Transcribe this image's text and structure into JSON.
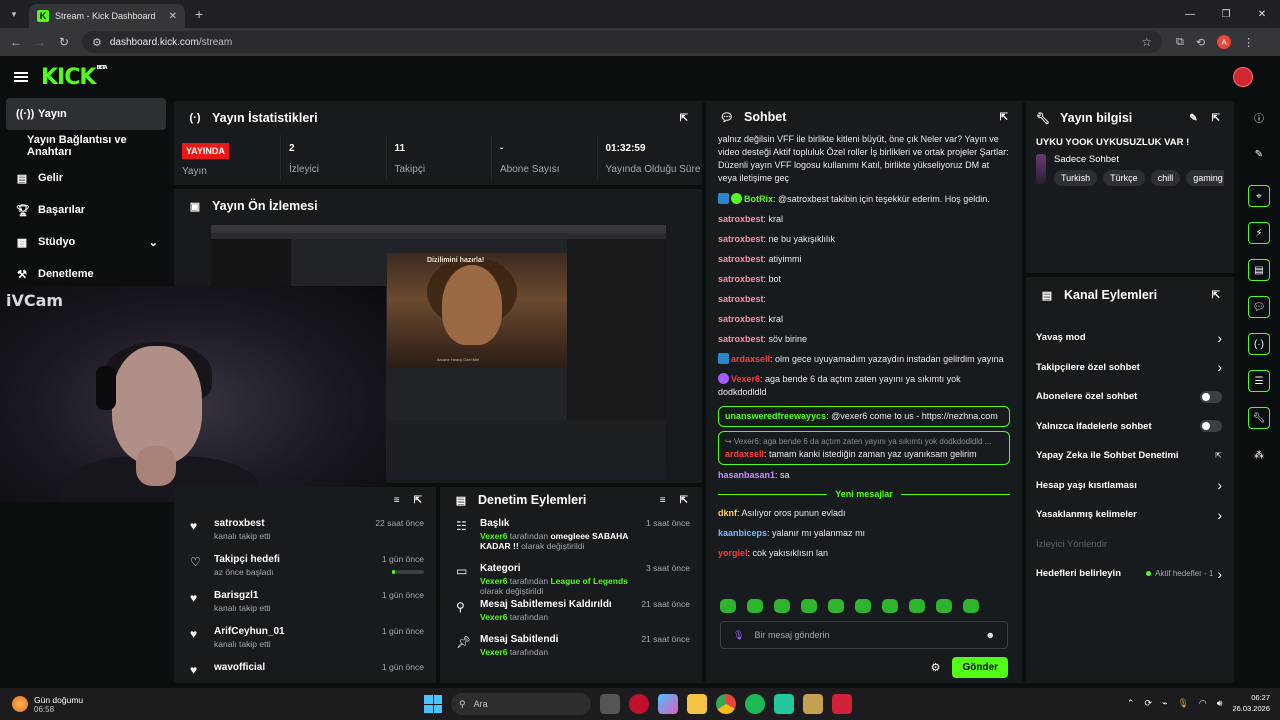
{
  "browser": {
    "tab_title": "Stream - Kick Dashboard",
    "url_host": "dashboard.kick.com",
    "url_path": "/stream",
    "profile_initial": "A"
  },
  "kick": {
    "logo": "KICK",
    "beta": "BETA"
  },
  "sidebar": {
    "items": [
      {
        "label": "Yayın",
        "icon": "broadcast-icon"
      },
      {
        "label": "Yayın Bağlantısı ve Anahtarı"
      },
      {
        "label": "Gelir",
        "icon": "chart-icon"
      },
      {
        "label": "Başarılar",
        "icon": "trophy-icon"
      },
      {
        "label": "Stüdyo",
        "icon": "studio-icon"
      },
      {
        "label": "Denetleme",
        "icon": "hammer-icon"
      }
    ]
  },
  "stats": {
    "title": "Yayın İstatistikleri",
    "live_badge": "YAYINDA",
    "status_label": "Yayın",
    "cells": [
      {
        "value": "2",
        "label": "İzleyici"
      },
      {
        "value": "11",
        "label": "Takipçi"
      },
      {
        "value": "-",
        "label": "Abone Sayısı"
      },
      {
        "value": "01:32:59",
        "label": "Yayında Olduğu Süre"
      }
    ]
  },
  "preview": {
    "title": "Yayın Ön İzlemesi",
    "overlay": "Dizilimini hazırla!",
    "caption": "Arcane Heavy Özel Mel"
  },
  "webcam": {
    "label": "iVCam"
  },
  "activity": {
    "items": [
      {
        "title": "satroxbest",
        "sub": "kanalı takip etti",
        "time": "22 saat önce"
      },
      {
        "title": "Takipçi hedefi",
        "sub": "az önce başladı",
        "time": "1 gün önce",
        "progress": 0.1
      },
      {
        "title": "Barisgzl1",
        "sub": "kanalı takip etti",
        "time": "1 gün önce"
      },
      {
        "title": "ArifCeyhun_01",
        "sub": "kanalı takip etti",
        "time": "1 gün önce"
      },
      {
        "title": "wavofficial",
        "sub": "",
        "time": "1 gün önce"
      }
    ]
  },
  "moderation": {
    "title": "Denetim Eylemleri",
    "items": [
      {
        "title": "Başlık",
        "user": "Vexer6",
        "mid": " tarafından ",
        "value": "omegleee SABAHA KADAR !!",
        "tail": " olarak değiştirildi",
        "time": "1 saat önce"
      },
      {
        "title": "Kategori",
        "user": "Vexer6",
        "mid": " tarafından ",
        "value": "League of Legends",
        "tail": " olarak değiştirildi",
        "time": "3 saat önce"
      },
      {
        "title": "Mesaj Sabitlemesi Kaldırıldı",
        "user": "Vexer6",
        "mid": " tarafından",
        "value": "",
        "tail": "",
        "time": "21 saat önce"
      },
      {
        "title": "Mesaj Sabitlendi",
        "user": "Vexer6",
        "mid": " tarafından",
        "value": "",
        "tail": "",
        "time": "21 saat önce"
      }
    ]
  },
  "chat": {
    "title": "Sohbet",
    "pinned_text": "yalnız değilsin VFF ile birlikte kitleni büyüt, öne çık Neler var? Yayın ve video desteği Aktif topluluk Özel roller İş birlikleri ve ortak projeler Şartlar: Düzenli yayın VFF logosu kullanımı Katıl, birlikte yükseliyoruz DM at veya iletişime geç",
    "messages": [
      {
        "user": "BotRix",
        "color": "#53fc18",
        "text": ": @satroxbest takibin için teşekkür ederim. Hoş geldin.",
        "badges": [
          "blue",
          "green"
        ]
      },
      {
        "user": "satroxbest",
        "color": "#ff8fa3",
        "text": ": kral"
      },
      {
        "user": "satroxbest",
        "color": "#ff8fa3",
        "text": ": ne bu yakışıklılık"
      },
      {
        "user": "satroxbest",
        "color": "#ff8fa3",
        "text": ": atiyimmi"
      },
      {
        "user": "satroxbest",
        "color": "#ff8fa3",
        "text": ": bot"
      },
      {
        "user": "satroxbest",
        "color": "#ff8fa3",
        "text": ": "
      },
      {
        "user": "satroxbest",
        "color": "#ff8fa3",
        "text": ": kral"
      },
      {
        "user": "satroxbest",
        "color": "#ff8fa3",
        "text": ": söv birine"
      },
      {
        "user": "ardaxsell",
        "color": "#ff3b3b",
        "text": ": olm gece uyuyamadım yazaydın instadan gelirdim yayına",
        "badges": [
          "blue"
        ]
      },
      {
        "user": "Vexer6",
        "color": "#ff3b3b",
        "text": ": aga bende 6 da açtım zaten yayını ya sıkımtı yok dodkdodldld",
        "badges": [
          "purple"
        ]
      },
      {
        "user": "unansweredfreewayycs",
        "color": "#53fc18",
        "text": ": @vexer6 come to us - https://nezhna.com",
        "boxed": true
      },
      {
        "user": "ardaxsell",
        "color": "#ff3b3b",
        "text": ": tamam kanki istediğin zaman yaz uyanıksam gelirim",
        "boxed": true,
        "reply": "Vexer6: aga bende 6 da açtım zaten yayını ya sıkımtı yok dodkdodldld ..."
      },
      {
        "user": "hasanbasan1",
        "color": "#c98cff",
        "text": ": sa"
      }
    ],
    "new_messages_label": "Yeni mesajlar",
    "new_messages": [
      {
        "user": "dknf",
        "color": "#ffcf5c",
        "text": ": Asılıyor oros punun evladı"
      },
      {
        "user": "kaanbiceps",
        "color": "#7ab8ff",
        "text": ": yalanır mı yalanmaz mı"
      },
      {
        "user": "yorgiel",
        "color": "#ff3b3b",
        "text": ": cok yakısıklısın lan"
      }
    ],
    "input_placeholder": "Bir mesaj gönderin",
    "send_label": "Gönder"
  },
  "info": {
    "title": "Yayın bilgisi",
    "stream_title": "UYKU YOOK UYKUSUZLUK VAR !",
    "chat_mode": "Sadece Sohbet",
    "tags": [
      "Turkish",
      "Türkçe",
      "chill",
      "gaming"
    ]
  },
  "channel_actions": {
    "title": "Kanal Eylemleri",
    "rows": [
      {
        "label": "Yavaş mod",
        "control": "chevron"
      },
      {
        "label": "Takipçilere özel sohbet",
        "control": "chevron"
      },
      {
        "label": "Abonelere özel sohbet",
        "control": "toggle"
      },
      {
        "label": "Yalnızca ifadelerle sohbet",
        "control": "toggle"
      },
      {
        "label": "Yapay Zeka ile Sohbet Denetimi",
        "control": "external"
      },
      {
        "label": "Hesap yaşı kısıtlaması",
        "control": "chevron"
      },
      {
        "label": "Yasaklanmış kelimeler",
        "control": "chevron"
      },
      {
        "label": "İzleyici Yönlendir",
        "control": "none",
        "dim": true
      },
      {
        "label": "Hedefleri belirleyin",
        "control": "goal",
        "note": "Aktif hedefler - 1"
      }
    ]
  },
  "taskbar": {
    "weather_title": "Gün doğumu",
    "weather_time": "06:58",
    "search_label": "Ara",
    "time": "06:27",
    "date": "26.03.2026"
  }
}
